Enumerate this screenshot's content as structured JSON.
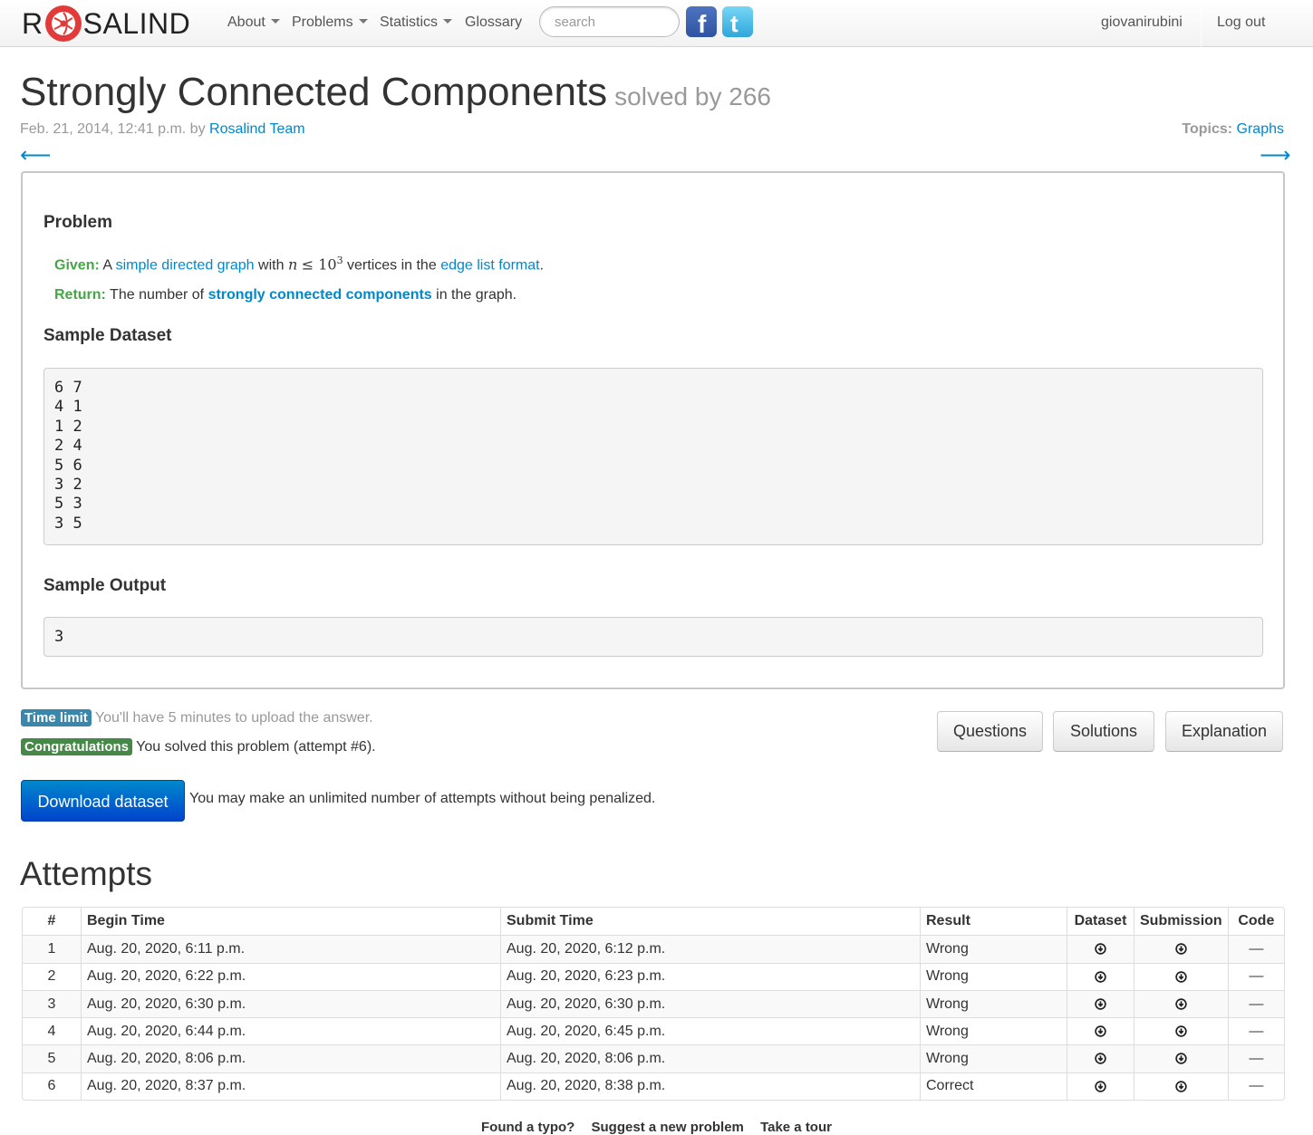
{
  "nav": {
    "brand_left": "R",
    "brand_right": "SALIND",
    "menu": [
      {
        "label": "About",
        "dropdown": true
      },
      {
        "label": "Problems",
        "dropdown": true
      },
      {
        "label": "Statistics",
        "dropdown": true
      },
      {
        "label": "Glossary",
        "dropdown": false
      }
    ],
    "search_placeholder": "search",
    "user": "giovanirubini",
    "logout": "Log out"
  },
  "problem": {
    "title": "Strongly Connected Components",
    "solved_by": "solved by 266",
    "date": "Feb. 21, 2014, 12:41 p.m. by",
    "author": "Rosalind Team",
    "topics_label": "Topics:",
    "topic": "Graphs",
    "prev_arrow": "⟵",
    "next_arrow": "⟶",
    "section_problem": "Problem",
    "given_label": "Given:",
    "given_a": "A",
    "given_link1": "simple directed graph",
    "given_with": "with",
    "given_math_n": "n",
    "given_math_le": "≤ 10",
    "given_math_exp": "3",
    "given_vertices": "vertices in the",
    "given_link2": "edge list format",
    "given_period": ".",
    "return_label": "Return:",
    "return_pre": "The number of",
    "return_link": "strongly connected components",
    "return_post": "in the graph.",
    "sample_dataset_heading": "Sample Dataset",
    "sample_dataset": "6 7\n4 1\n1 2\n2 4\n5 6\n3 2\n5 3\n3 5",
    "sample_output_heading": "Sample Output",
    "sample_output": "3"
  },
  "status": {
    "time_limit_label": "Time limit",
    "time_limit_text": "You'll have 5 minutes to upload the answer.",
    "congrats_label": "Congratulations",
    "congrats_text": "You solved this problem (attempt #6)."
  },
  "buttons": {
    "questions": "Questions",
    "solutions": "Solutions",
    "explanation": "Explanation",
    "download": "Download dataset",
    "unlimited_text": "You may make an unlimited number of attempts without being penalized."
  },
  "attempts": {
    "heading": "Attempts",
    "columns": [
      "#",
      "Begin Time",
      "Submit Time",
      "Result",
      "Dataset",
      "Submission",
      "Code"
    ],
    "rows": [
      {
        "num": "1",
        "begin": "Aug. 20, 2020, 6:11 p.m.",
        "submit": "Aug. 20, 2020, 6:12 p.m.",
        "result": "Wrong",
        "code": "—"
      },
      {
        "num": "2",
        "begin": "Aug. 20, 2020, 6:22 p.m.",
        "submit": "Aug. 20, 2020, 6:23 p.m.",
        "result": "Wrong",
        "code": "—"
      },
      {
        "num": "3",
        "begin": "Aug. 20, 2020, 6:30 p.m.",
        "submit": "Aug. 20, 2020, 6:30 p.m.",
        "result": "Wrong",
        "code": "—"
      },
      {
        "num": "4",
        "begin": "Aug. 20, 2020, 6:44 p.m.",
        "submit": "Aug. 20, 2020, 6:45 p.m.",
        "result": "Wrong",
        "code": "—"
      },
      {
        "num": "5",
        "begin": "Aug. 20, 2020, 8:06 p.m.",
        "submit": "Aug. 20, 2020, 8:06 p.m.",
        "result": "Wrong",
        "code": "—"
      },
      {
        "num": "6",
        "begin": "Aug. 20, 2020, 8:37 p.m.",
        "submit": "Aug. 20, 2020, 8:38 p.m.",
        "result": "Correct",
        "code": "—"
      }
    ]
  },
  "footer": {
    "links": [
      "Found a typo?",
      "Suggest a new problem",
      "Take a tour"
    ]
  },
  "colors": {
    "link": "#0088cc",
    "given_green": "#46a546",
    "label_info": "#3a87ad",
    "label_success": "#468847",
    "primary_button": "#0055cc"
  }
}
